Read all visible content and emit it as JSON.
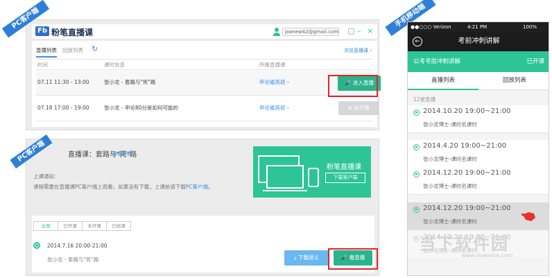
{
  "ribbon_pc_top": "PC客户端",
  "ribbon_pc_bottom": "PC客户端",
  "ribbon_mobile": "手机移动端",
  "pc_window": {
    "logo_badge": "Fb",
    "app_name": "粉笔直播课",
    "email": "pwnew42@gmail.com",
    "window_buttons": [
      "▢",
      "–",
      "×"
    ]
  },
  "pc_list": {
    "tab_live": "直播列表",
    "tab_replay": "回放列表",
    "more_link": "浏览直播课 ›",
    "headers": [
      "时间",
      "课时信息",
      "所属直播课"
    ],
    "rows": [
      {
        "time": "07.11 11:30 - 13:00",
        "info": "张小龙 - 套路与\"死\"路",
        "course": "申论催高班 ›",
        "action": "进入直播"
      },
      {
        "time": "07.18 17:00 - 19:00",
        "info": "张小龙 - 申论80分是如何可能的",
        "course": "申论催高班 ›",
        "action": "未开播"
      }
    ]
  },
  "pc_course": {
    "title": "直播课：套路与\"死\"路",
    "detail_link": "查看详情",
    "notice_label": "上课通知:",
    "notice_text": "课程需要在直播课PC客户端上观看，如果没有下载，上课前请下载",
    "notice_link": "PC客户端。",
    "banner_title": "粉笔直播课",
    "banner_download": "下载客户端",
    "filters": [
      "全部",
      "已开课",
      "未开课",
      "已结课"
    ],
    "item_date": "2014.7.16 20:00-21:00",
    "item_name": "张小龙 - 套路与\"死\"路",
    "download_notes": "下载讲义",
    "watch_live": "看直播"
  },
  "mobile": {
    "carrier": "●●○○○ Verizon",
    "time": "4:21 PM",
    "battery": "100%",
    "nav_title": "考前冲刺讲解",
    "course_name": "公考考前冲刺讲解",
    "course_status": "已开课",
    "tab_live": "直播列表",
    "tab_replay": "回放列表",
    "section": "12堂直播",
    "items": [
      {
        "date": "2014.10.20  19:00~21:00",
        "name": "张小龙博士-课时名课时"
      },
      {
        "date": "2014.4.20  19:00~21:00",
        "name": "张小龙博士-课时名课时"
      },
      {
        "date": "2014.12.20  19:00~21:00",
        "name": "张小龙博士-课时名课时"
      },
      {
        "date": "2014.12.20  19:00~21:00",
        "name": "张小龙博士-课时名课时"
      },
      {
        "date": "2014.12.20  19:00~21:00",
        "name": "张小龙博士-课时名课时"
      }
    ]
  },
  "watermark": {
    "title": "当下软件园",
    "url": "www.downxia.com"
  }
}
